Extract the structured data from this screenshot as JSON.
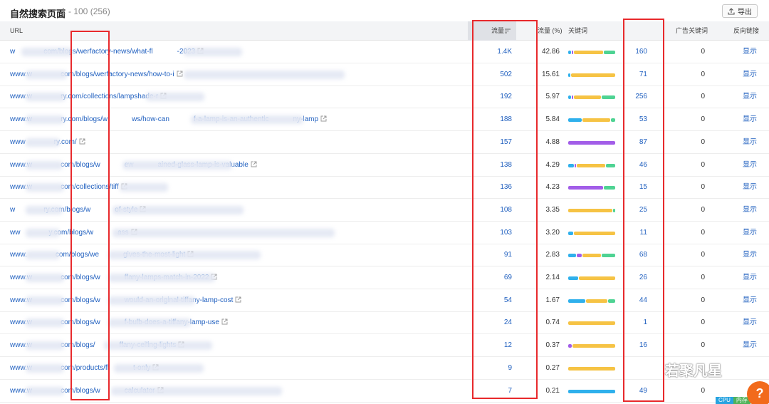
{
  "header": {
    "title": "自然搜索页面",
    "range": "1 - 100 (256)",
    "export_label": "导出"
  },
  "columns": {
    "url": "URL",
    "traffic": "流量",
    "traffic_pct": "流量 (%)",
    "keywords_bar": "关键词",
    "keywords": "",
    "ad_keywords": "广告关键词",
    "backlinks": "反向链接"
  },
  "colors": {
    "link": "#1f5fbf",
    "bar_blue": "#2fb0ec",
    "bar_purple": "#a25de8",
    "bar_yellow": "#f6c344",
    "bar_green": "#4ed393",
    "annotation_red": "#e8292c",
    "help_orange": "#f26a1b"
  },
  "rows": [
    {
      "url_start": "w",
      "url_end": "com/blogs/werfactory-news/what-fl",
      "url_tail": "-2023",
      "traffic": "1.4K",
      "pct": "42.86",
      "kw": "160",
      "ads": "0",
      "backlinks": "显示",
      "bar": [
        {
          "c": "bar_blue",
          "w": 0.06
        },
        {
          "c": "bar_purple",
          "w": 0.04
        },
        {
          "c": "bar_yellow",
          "w": 0.65
        },
        {
          "c": "bar_green",
          "w": 0.25
        }
      ]
    },
    {
      "url_start": "www.w",
      "url_end": "com/blogs/werfactory-news/how-to-i",
      "url_tail": "",
      "traffic": "502",
      "pct": "15.61",
      "kw": "71",
      "ads": "0",
      "backlinks": "显示",
      "bar": [
        {
          "c": "bar_blue",
          "w": 0.05
        },
        {
          "c": "bar_yellow",
          "w": 0.95
        }
      ]
    },
    {
      "url_start": "www.w",
      "url_end": "ry.com/collections/lampshade-r",
      "url_tail": "",
      "traffic": "192",
      "pct": "5.97",
      "kw": "256",
      "ads": "0",
      "backlinks": "显示",
      "bar": [
        {
          "c": "bar_blue",
          "w": 0.06
        },
        {
          "c": "bar_purple",
          "w": 0.04
        },
        {
          "c": "bar_yellow",
          "w": 0.6
        },
        {
          "c": "bar_green",
          "w": 0.3
        }
      ]
    },
    {
      "url_start": "www.w",
      "url_end": "ry.com/blogs/w",
      "url_tail": "ws/how-can",
      "url_tail2": "f-a-lamp-is-an-authentic",
      "url_tail3": "ny-lamp",
      "traffic": "188",
      "pct": "5.84",
      "kw": "53",
      "ads": "0",
      "backlinks": "显示",
      "bar": [
        {
          "c": "bar_blue",
          "w": 0.3
        },
        {
          "c": "bar_yellow",
          "w": 0.6
        },
        {
          "c": "bar_green",
          "w": 0.1
        }
      ]
    },
    {
      "url_start": "www",
      "url_end": "ry.com/",
      "url_tail": "",
      "traffic": "157",
      "pct": "4.88",
      "kw": "87",
      "ads": "0",
      "backlinks": "显示",
      "bar": [
        {
          "c": "bar_purple",
          "w": 1.0
        }
      ]
    },
    {
      "url_start": "www.w",
      "url_end": "com/blogs/w",
      "url_tail": "ew",
      "url_tail2": "ained-glass-lamp-is-valuable",
      "traffic": "138",
      "pct": "4.29",
      "kw": "46",
      "ads": "0",
      "backlinks": "显示",
      "bar": [
        {
          "c": "bar_blue",
          "w": 0.12
        },
        {
          "c": "bar_purple",
          "w": 0.04
        },
        {
          "c": "bar_yellow",
          "w": 0.64
        },
        {
          "c": "bar_green",
          "w": 0.2
        }
      ]
    },
    {
      "url_start": "www.w",
      "url_end": "com/collections/tiff",
      "url_tail": "",
      "traffic": "136",
      "pct": "4.23",
      "kw": "15",
      "ads": "0",
      "backlinks": "显示",
      "bar": [
        {
          "c": "bar_purple",
          "w": 0.75
        },
        {
          "c": "bar_green",
          "w": 0.25
        }
      ]
    },
    {
      "url_start": "w",
      "url_end": "ry.com/blogs/w",
      "url_tail": "of-style",
      "traffic": "108",
      "pct": "3.35",
      "kw": "25",
      "ads": "0",
      "backlinks": "显示",
      "bar": [
        {
          "c": "bar_yellow",
          "w": 0.95
        },
        {
          "c": "bar_green",
          "w": 0.05
        }
      ]
    },
    {
      "url_start": "ww",
      "url_end": "y.com/blogs/w",
      "url_tail": "ass",
      "traffic": "103",
      "pct": "3.20",
      "kw": "11",
      "ads": "0",
      "backlinks": "显示",
      "bar": [
        {
          "c": "bar_blue",
          "w": 0.1
        },
        {
          "c": "bar_yellow",
          "w": 0.9
        }
      ]
    },
    {
      "url_start": "www.",
      "url_end": "com/blogs/we",
      "url_tail": "gives-the-most-light",
      "traffic": "91",
      "pct": "2.83",
      "kw": "68",
      "ads": "0",
      "backlinks": "显示",
      "bar": [
        {
          "c": "bar_blue",
          "w": 0.18
        },
        {
          "c": "bar_purple",
          "w": 0.1
        },
        {
          "c": "bar_yellow",
          "w": 0.42
        },
        {
          "c": "bar_green",
          "w": 0.3
        }
      ]
    },
    {
      "url_start": "www.w",
      "url_end": "com/blogs/w",
      "url_tail": "ffany-lamps-match-in-2022",
      "traffic": "69",
      "pct": "2.14",
      "kw": "26",
      "ads": "0",
      "backlinks": "显示",
      "bar": [
        {
          "c": "bar_blue",
          "w": 0.22
        },
        {
          "c": "bar_yellow",
          "w": 0.78
        }
      ]
    },
    {
      "url_start": "www.w",
      "url_end": "com/blogs/w",
      "url_tail": "would-an-original-tiffany-lamp-cost",
      "traffic": "54",
      "pct": "1.67",
      "kw": "44",
      "ads": "0",
      "backlinks": "显示",
      "bar": [
        {
          "c": "bar_blue",
          "w": 0.38
        },
        {
          "c": "bar_yellow",
          "w": 0.46
        },
        {
          "c": "bar_green",
          "w": 0.16
        }
      ]
    },
    {
      "url_start": "www.w",
      "url_end": "com/blogs/w",
      "url_tail": "f-bulb-does-a-tiffany-lamp-use",
      "traffic": "24",
      "pct": "0.74",
      "kw": "1",
      "ads": "0",
      "backlinks": "显示",
      "bar": [
        {
          "c": "bar_yellow",
          "w": 1.0
        }
      ]
    },
    {
      "url_start": "www.w",
      "url_end": "com/blogs/",
      "url_tail": "ffany-ceiling-lights",
      "traffic": "12",
      "pct": "0.37",
      "kw": "16",
      "ads": "0",
      "backlinks": "显示",
      "bar": [
        {
          "c": "bar_purple",
          "w": 0.08
        },
        {
          "c": "bar_yellow",
          "w": 0.92
        }
      ]
    },
    {
      "url_start": "www.w",
      "url_end": "com/products/fl",
      "url_tail": "t-only",
      "traffic": "9",
      "pct": "0.27",
      "kw": "",
      "ads": "",
      "backlinks": "",
      "bar": [
        {
          "c": "bar_yellow",
          "w": 1.0
        }
      ]
    },
    {
      "url_start": "www.w",
      "url_end": "com/blogs/w",
      "url_tail": "calculator",
      "traffic": "7",
      "pct": "0.21",
      "kw": "49",
      "ads": "0",
      "backlinks": "",
      "bar": [
        {
          "c": "bar_blue",
          "w": 1.0
        }
      ]
    }
  ],
  "watermark": {
    "text": "若聚凡星"
  },
  "help": {
    "label": "?"
  },
  "status": {
    "cpu": "CPU",
    "mem": "内存"
  }
}
